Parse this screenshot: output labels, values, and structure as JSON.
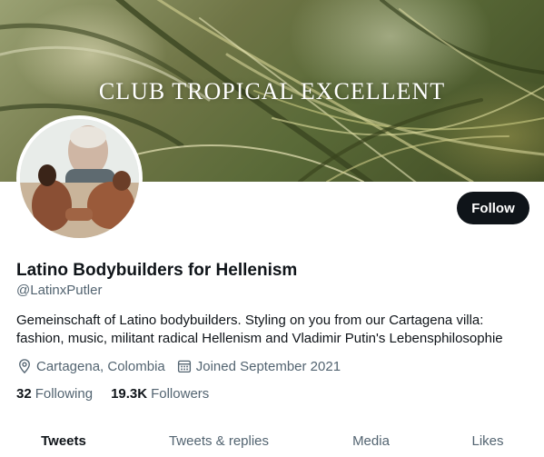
{
  "banner": {
    "title": "CLUB TROPICAL EXCELLENT"
  },
  "profile": {
    "name": "Latino Bodybuilders for Hellenism",
    "handle": "@LatinxPutler",
    "bio_line1": "Gemeinschaft of Latino bodybuilders. Styling on you from our Cartagena villa:",
    "bio_line2": "fashion, music, militant radical Hellenism and Vladimir Putin's Lebensphilosophie",
    "location": "Cartagena, Colombia",
    "joined": "Joined September 2021",
    "location_icon": "location-pin-icon",
    "joined_icon": "calendar-icon"
  },
  "actions": {
    "follow_label": "Follow"
  },
  "stats": {
    "following_count": "32",
    "following_label": "Following",
    "followers_count": "19.3K",
    "followers_label": "Followers"
  },
  "tabs": [
    {
      "label": "Tweets",
      "active": true
    },
    {
      "label": "Tweets & replies",
      "active": false
    },
    {
      "label": "Media",
      "active": false
    },
    {
      "label": "Likes",
      "active": false
    }
  ],
  "colors": {
    "primary_text": "#0f1419",
    "secondary_text": "#536471",
    "button_bg": "#0f1419",
    "button_text": "#ffffff"
  }
}
